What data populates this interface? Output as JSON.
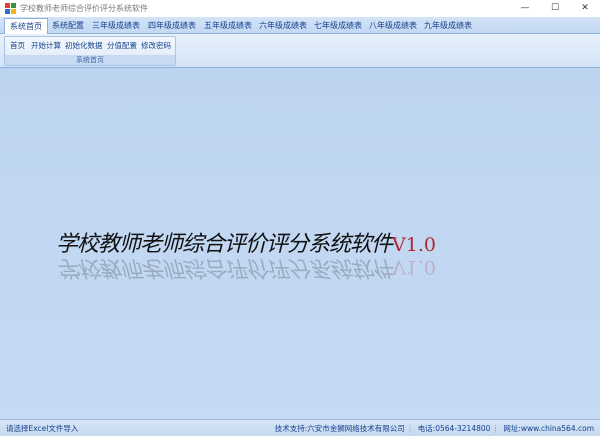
{
  "window": {
    "title": "学校教师老师综合评价评分系统软件",
    "minimize_glyph": "—",
    "maximize_glyph": "☐",
    "close_glyph": "✕"
  },
  "tabs": [
    {
      "label": "系统首页",
      "active": true
    },
    {
      "label": "系统配置"
    },
    {
      "label": "三年级成绩表"
    },
    {
      "label": "四年级成绩表"
    },
    {
      "label": "五年级成绩表"
    },
    {
      "label": "六年级成绩表"
    },
    {
      "label": "七年级成绩表"
    },
    {
      "label": "八年级成绩表"
    },
    {
      "label": "九年级成绩表"
    }
  ],
  "ribbon": {
    "group_label": "系统首页",
    "buttons": [
      "首页",
      "开始计算",
      "初始化数据",
      "分值配置",
      "修改密码"
    ]
  },
  "banner": {
    "text": "学校教师老师综合评价评分系统软件",
    "version": "V1.0"
  },
  "status": {
    "left": "请选择Excel文件导入",
    "support": "技术支持:六安市金狮网络技术有限公司",
    "phone": "电话:0564-3214800",
    "website": "网址:www.china564.com"
  },
  "colors": {
    "accent": "#15428b",
    "background": "#bcd3ef",
    "version": "#b0282e"
  }
}
